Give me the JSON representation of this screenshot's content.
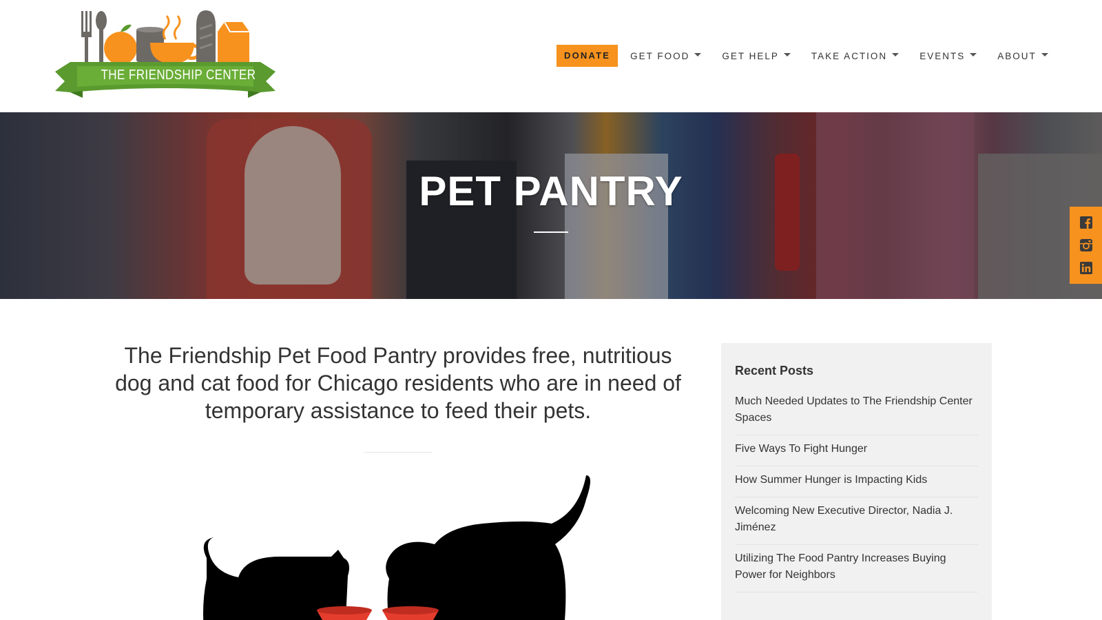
{
  "logo": {
    "text": "THE FRIENDSHIP CENTER"
  },
  "nav": {
    "donate": "DONATE",
    "items": [
      "GET FOOD",
      "GET HELP",
      "TAKE ACTION",
      "EVENTS",
      "ABOUT"
    ]
  },
  "hero": {
    "title": "PET PANTRY"
  },
  "intro": "The Friendship Pet Food Pantry provides free, nutritious dog and cat food for Chicago residents who are in need of temporary assistance to feed their pets.",
  "sidebar": {
    "heading": "Recent Posts",
    "posts": [
      "Much Needed Updates to The Friendship Center Spaces",
      "Five Ways To Fight Hunger",
      "How Summer Hunger is Impacting Kids",
      "Welcoming New Executive Director, Nadia J. Jiménez",
      "Utilizing The Food Pantry Increases Buying Power for Neighbors"
    ]
  },
  "social": [
    "facebook-icon",
    "instagram-icon",
    "linkedin-icon"
  ],
  "colors": {
    "accent": "#f7921e",
    "logo_green": "#5a9a2e",
    "logo_orange": "#f7921e"
  }
}
